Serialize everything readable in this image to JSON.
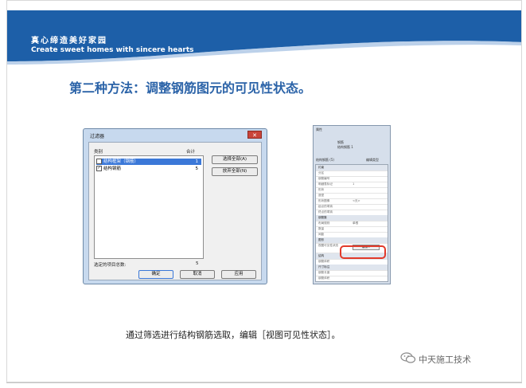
{
  "brand": {
    "name_cn": "真心缔造美好家园",
    "slogan_en": "Create sweet homes with sincere hearts"
  },
  "colors": {
    "banner": "#1d5fa8",
    "heading": "#2b63a8",
    "highlight": "#e23a2a",
    "selection": "#3b78d8"
  },
  "heading": "第二种方法：调整钢筋图元的可见性状态。",
  "filter_dialog": {
    "title": "过滤器",
    "col_category": "类别",
    "col_count": "合计",
    "items": [
      {
        "label": "结构框架（钢筋）",
        "count": "1",
        "checked": false,
        "selected": true
      },
      {
        "label": "结构钢筋",
        "count": "5",
        "checked": true,
        "selected": false
      }
    ],
    "select_all": "选择全部(A)",
    "deselect_all": "放弃全部(N)",
    "total_label": "选定的项目总数:",
    "total_value": "5",
    "ok": "确定",
    "cancel": "取消",
    "apply": "应用",
    "close_icon": "close-icon"
  },
  "properties": {
    "title": "属性",
    "type_line1": "钢筋",
    "type_line2": "结构钢筋 1",
    "selector": "结构钢筋 (5)",
    "edit_type": "编辑类型",
    "groups": [
      {
        "name": "约束",
        "rows": []
      },
      {
        "name": "",
        "rows": [
          {
            "key": "分区",
            "value": ""
          },
          {
            "key": "钢筋编号",
            "value": ""
          },
          {
            "key": "明细表标记",
            "value": "1"
          },
          {
            "key": "形状",
            "value": ""
          },
          {
            "key": "造型",
            "value": ""
          },
          {
            "key": "形状图像",
            "value": "<无>"
          },
          {
            "key": "起点的弯钩",
            "value": ""
          },
          {
            "key": "终点的弯钩",
            "value": ""
          }
        ]
      },
      {
        "name": "钢筋集",
        "rows": [
          {
            "key": "布局规则",
            "value": "单根"
          },
          {
            "key": "数量",
            "value": ""
          },
          {
            "key": "间距",
            "value": ""
          }
        ]
      },
      {
        "name": "图形",
        "rows": [
          {
            "key": "视图可见性状态",
            "value": "编辑..."
          }
        ]
      },
      {
        "name": "结构",
        "rows": [
          {
            "key": "钢筋体积",
            "value": ""
          }
        ]
      },
      {
        "name": "尺寸标注",
        "rows": [
          {
            "key": "钢筋长度",
            "value": ""
          },
          {
            "key": "钢筋体积",
            "value": ""
          }
        ]
      }
    ]
  },
  "caption": "通过筛选进行结构钢筋选取，编辑［视图可见性状态］。",
  "watermark": {
    "icon": "wechat-icon",
    "text": "中天施工技术"
  }
}
